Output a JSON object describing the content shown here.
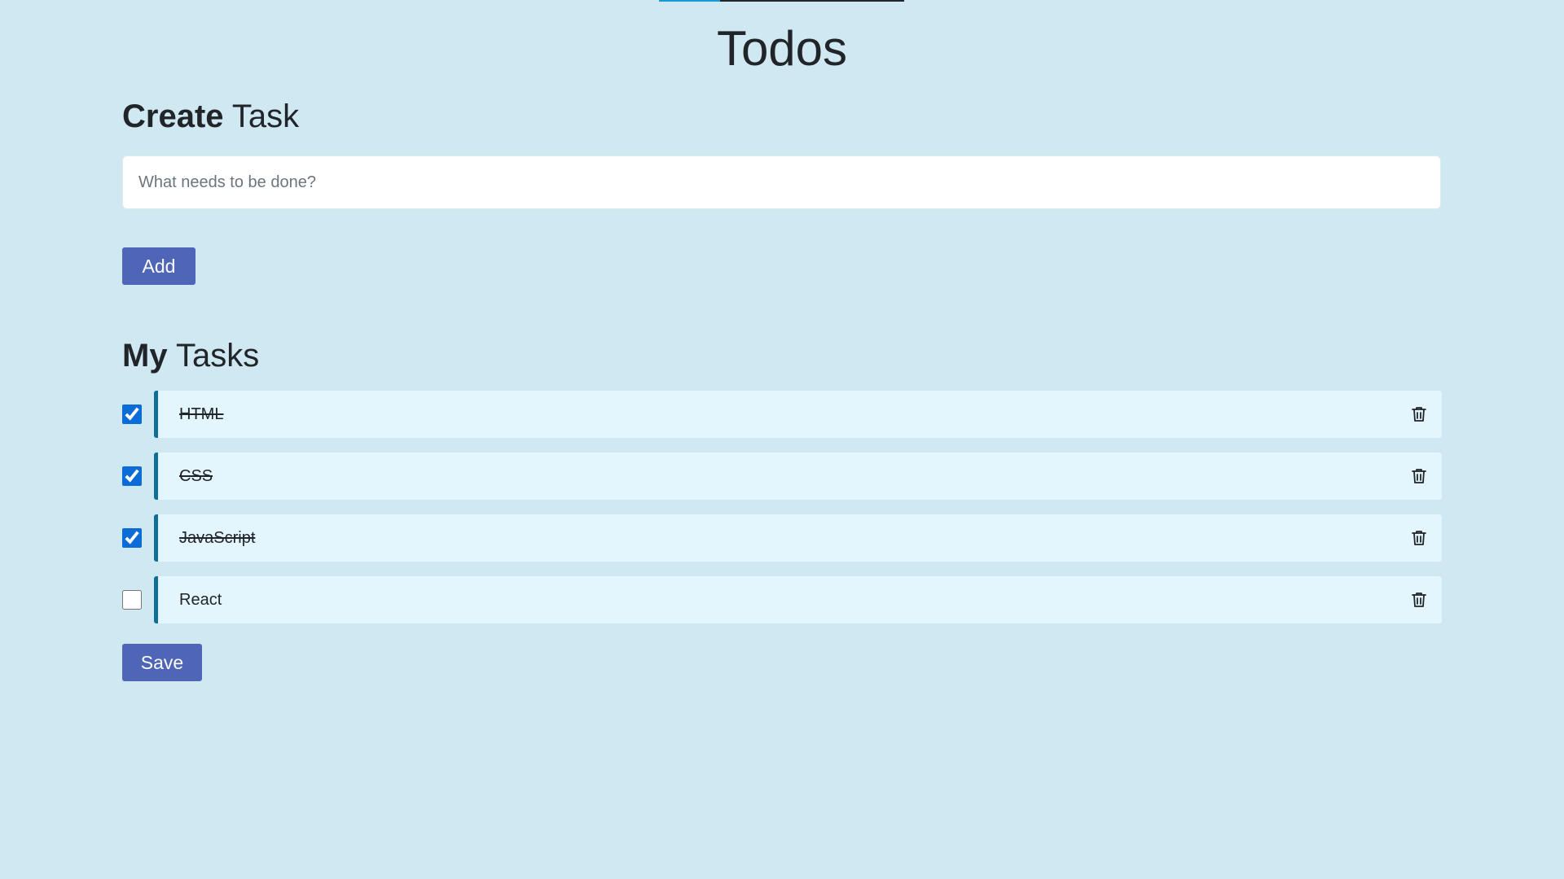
{
  "progress": 0.25,
  "header": {
    "title": "Todos"
  },
  "create": {
    "heading_strong": "Create",
    "heading_rest": " Task",
    "input_placeholder": "What needs to be done?",
    "input_value": "",
    "add_label": "Add"
  },
  "tasks_section": {
    "heading_strong": "My",
    "heading_rest": " Tasks"
  },
  "tasks": [
    {
      "name": "HTML",
      "done": true
    },
    {
      "name": "CSS",
      "done": true
    },
    {
      "name": "JavaScript",
      "done": true
    },
    {
      "name": "React",
      "done": false
    }
  ],
  "save_label": "Save",
  "icons": {
    "delete": "trash-icon"
  },
  "colors": {
    "background": "#d0e8f1",
    "button": "#4f65b8",
    "task_background": "#e4f6fd",
    "task_accent": "#0f6d96",
    "checkbox": "#0b6cd8",
    "progress": "#1a9bd7"
  }
}
